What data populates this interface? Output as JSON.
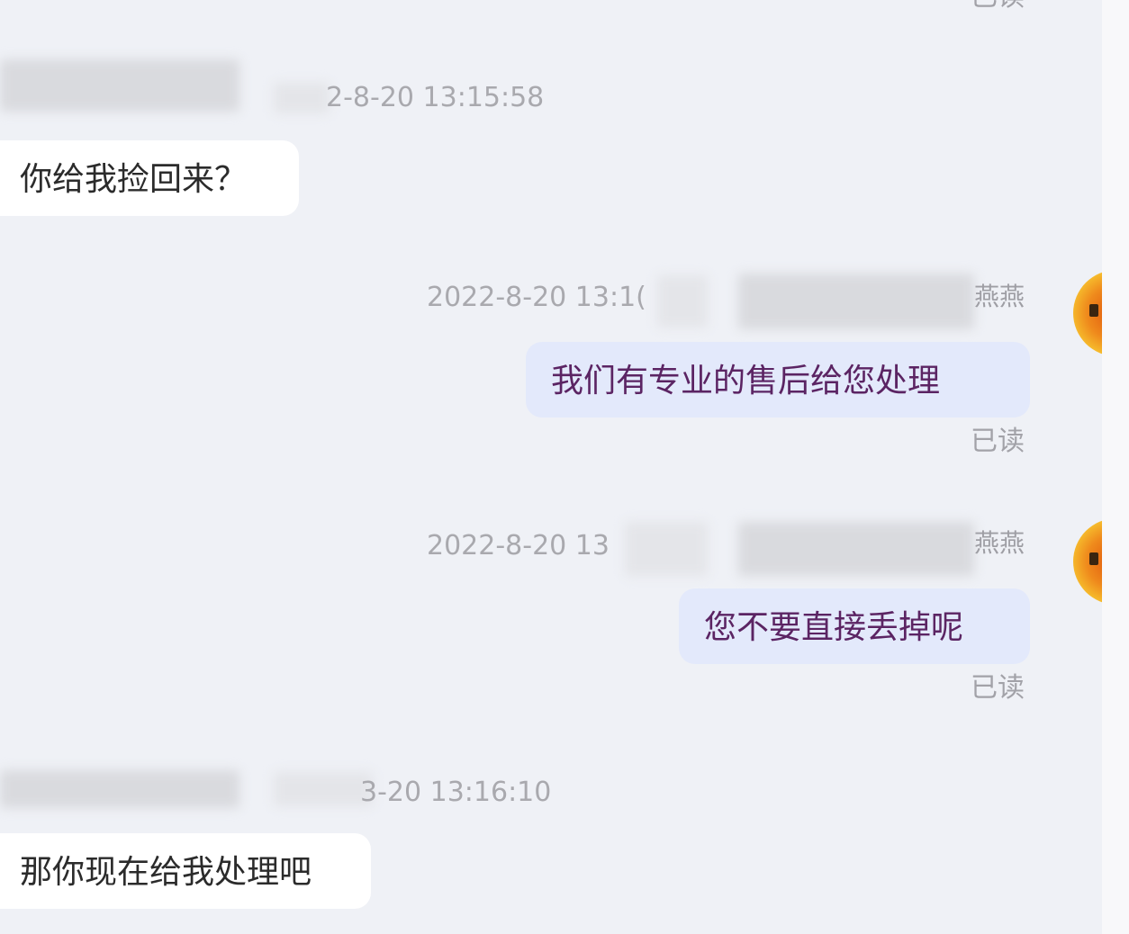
{
  "colors": {
    "chat_background": "#eff1f6",
    "incoming_bubble": "#ffffff",
    "outgoing_bubble": "#e3e9fb",
    "outgoing_text": "#5b2463",
    "meta_text": "#a9a9ae"
  },
  "top_read_status": "已读",
  "messages": [
    {
      "side": "left",
      "timestamp_visible": "2-8-20 13:15:58",
      "text": "你给我捡回来？"
    },
    {
      "side": "right",
      "timestamp_visible": "2022-8-20 13:1(",
      "sender_suffix": "燕燕",
      "text": "我们有专业的售后给您处理",
      "status": "已读",
      "avatar": "avatar-icon"
    },
    {
      "side": "right",
      "timestamp_visible": "2022-8-20 13",
      "sender_suffix": "燕燕",
      "text": "您不要直接丢掉呢",
      "status": "已读",
      "avatar": "avatar-icon"
    },
    {
      "side": "left",
      "timestamp_visible": "3-20 13:16:10",
      "text": "那你现在给我处理吧"
    }
  ]
}
